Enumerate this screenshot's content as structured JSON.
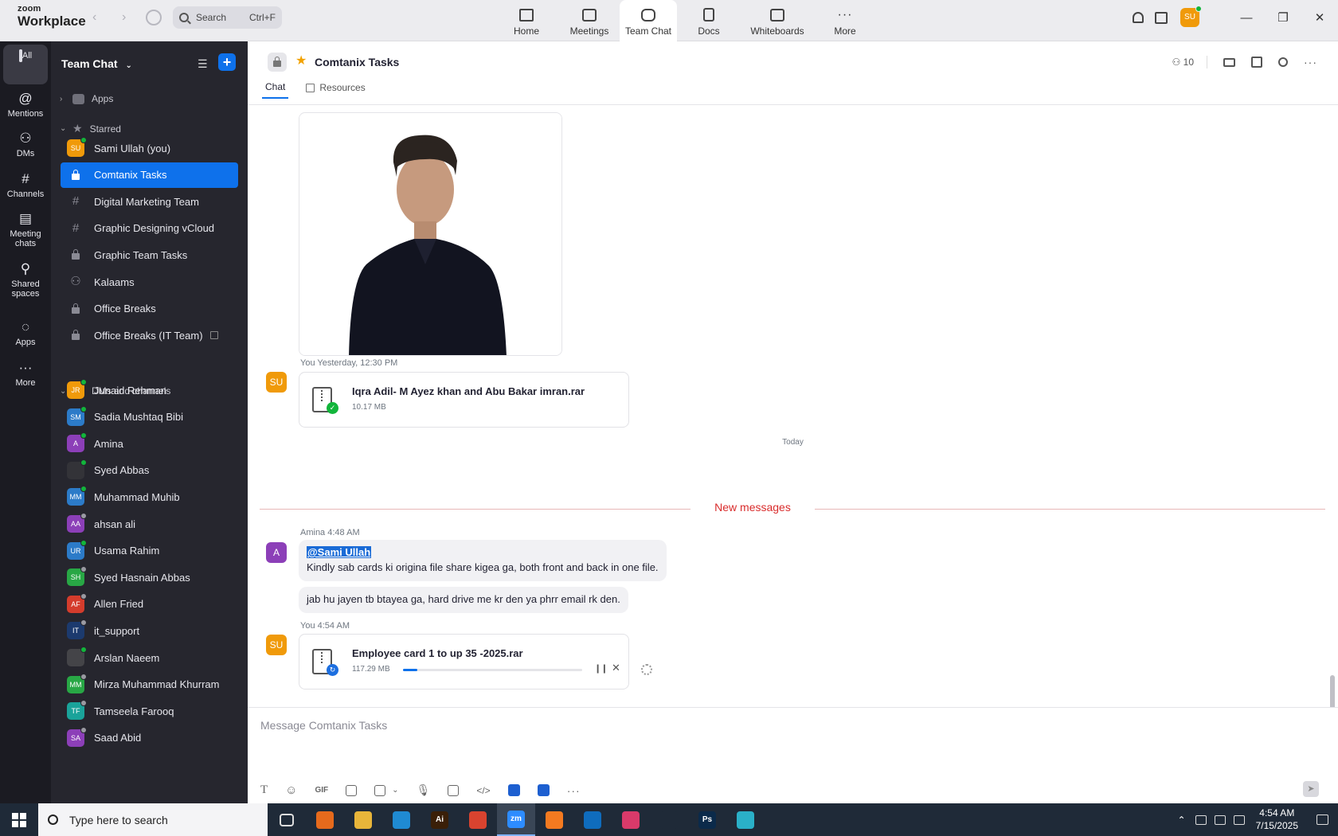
{
  "app": {
    "logo_small": "zoom",
    "logo_big": "Workplace"
  },
  "search": {
    "label": "Search",
    "shortcut": "Ctrl+F"
  },
  "topnav": [
    {
      "label": "Home",
      "icon": "home-icon"
    },
    {
      "label": "Meetings",
      "icon": "video-camera-icon"
    },
    {
      "label": "Team Chat",
      "icon": "chat-bubbles-icon",
      "active": true
    },
    {
      "label": "Docs",
      "icon": "document-icon"
    },
    {
      "label": "Whiteboards",
      "icon": "whiteboard-icon"
    },
    {
      "label": "More",
      "icon": "ellipsis-icon"
    }
  ],
  "user": {
    "initials": "SU",
    "status_color": "#12b53b",
    "avatar_color": "#f09a0a"
  },
  "rail": [
    {
      "label": "All",
      "glyph": "▣",
      "active": true
    },
    {
      "label": "Mentions",
      "glyph": "@"
    },
    {
      "label": "DMs",
      "glyph": "⚇"
    },
    {
      "label": "Channels",
      "glyph": "#"
    },
    {
      "label": "Meeting chats",
      "glyph": "▤"
    },
    {
      "label": "Shared spaces",
      "glyph": "⚲"
    },
    {
      "label": "Apps",
      "glyph": "◌"
    },
    {
      "label": "More",
      "glyph": "···"
    }
  ],
  "sidebar": {
    "title": "Team Chat",
    "sections": {
      "apps": "Apps",
      "starred": "Starred",
      "dms": "DMs and channels"
    },
    "starred": [
      {
        "label": "Sami Ullah (you)",
        "kind": "avatar",
        "initials": "SU",
        "color": "#f09a0a",
        "status": "#12b53b"
      },
      {
        "label": "Comtanix Tasks",
        "kind": "lock",
        "active": true
      },
      {
        "label": "Digital Marketing Team",
        "kind": "hash"
      },
      {
        "label": "Graphic Designing vCloud",
        "kind": "hash"
      },
      {
        "label": "Graphic Team Tasks",
        "kind": "lock"
      },
      {
        "label": "Kalaams",
        "kind": "group"
      },
      {
        "label": "Office Breaks",
        "kind": "lock"
      },
      {
        "label": "Office Breaks (IT Team)",
        "kind": "lock",
        "archived": true
      }
    ],
    "dms": [
      {
        "label": "Junaid Rehman",
        "initials": "JR",
        "color": "#f09a0a",
        "status": "#12b53b"
      },
      {
        "label": "Sadia Mushtaq Bibi",
        "initials": "SM",
        "color": "#2c7bc8",
        "status": "#12b53b"
      },
      {
        "label": "Amina",
        "initials": "A",
        "color": "#8c3fb8",
        "status": "#12b53b"
      },
      {
        "label": "Syed Abbas",
        "initials": "",
        "color": "#333338",
        "status": "#12b53b"
      },
      {
        "label": "Muhammad Muhib",
        "initials": "MM",
        "color": "#2c7bc8",
        "status": "#12b53b"
      },
      {
        "label": "ahsan ali",
        "initials": "AA",
        "color": "#8c3fb8",
        "status": "#9a9aa2"
      },
      {
        "label": "Usama Rahim",
        "initials": "UR",
        "color": "#2c7bc8",
        "status": "#12b53b"
      },
      {
        "label": "Syed Hasnain Abbas",
        "initials": "SH",
        "color": "#28a745",
        "status": "#9a9aa2"
      },
      {
        "label": "Allen Fried",
        "initials": "AF",
        "color": "#d43c2c",
        "status": "#9a9aa2"
      },
      {
        "label": "it_support",
        "initials": "IT",
        "color": "#1c3a6e",
        "status": "#9a9aa2"
      },
      {
        "label": "Arslan Naeem",
        "initials": "",
        "color": "#444448",
        "status": "#12b53b"
      },
      {
        "label": "Mirza Muhammad Khurram",
        "initials": "MM",
        "color": "#28a745",
        "status": "#9a9aa2"
      },
      {
        "label": "Tamseela Farooq",
        "initials": "TF",
        "color": "#1aa39a",
        "status": "#9a9aa2"
      },
      {
        "label": "Saad Abid",
        "initials": "SA",
        "color": "#8c3fb8",
        "status": "#9a9aa2"
      }
    ]
  },
  "channel": {
    "title": "Comtanix Tasks",
    "member_count": "10",
    "tabs": {
      "chat": "Chat",
      "resources": "Resources"
    }
  },
  "messages": {
    "file1": {
      "sender": "You",
      "time": "Yesterday, 12:30 PM",
      "initials": "SU",
      "name": "Iqra Adil- M Ayez khan and Abu Bakar imran.rar",
      "size": "10.17 MB"
    },
    "day_divider": "Today",
    "new_divider": "New messages",
    "amina": {
      "sender": "Amina",
      "time": "4:48 AM",
      "initials": "A",
      "mention": "@Sami Ullah",
      "line1": "Kindly sab cards ki origina file share kigea ga, both front and back in one file.",
      "line2": "jab hu jayen tb btayea ga, hard drive me kr den ya phrr email rk den."
    },
    "file2": {
      "sender": "You",
      "time": "4:54 AM",
      "initials": "SU",
      "name": "Employee card 1 to up 35 -2025.rar",
      "size": "117.29 MB",
      "progress": 0.08
    }
  },
  "composer": {
    "placeholder": "Message Comtanix Tasks",
    "gif": "GIF"
  },
  "taskbar": {
    "search_placeholder": "Type here to search",
    "time": "4:54 AM",
    "date": "7/15/2025",
    "apps": [
      {
        "name": "task-view",
        "color": "#1f2a38",
        "text": ""
      },
      {
        "name": "firefox",
        "color": "#e66a1c",
        "text": ""
      },
      {
        "name": "file-explorer",
        "color": "#e8b53a",
        "text": ""
      },
      {
        "name": "vscode",
        "color": "#1f8ad2",
        "text": ""
      },
      {
        "name": "illustrator",
        "color": "#3a1f08",
        "text": "Ai"
      },
      {
        "name": "chrome",
        "color": "#d9432f",
        "text": ""
      },
      {
        "name": "zoom",
        "color": "#2d8cff",
        "text": "zm",
        "active": true
      },
      {
        "name": "xampp",
        "color": "#f47a20",
        "text": ""
      },
      {
        "name": "outlook",
        "color": "#0f6cbd",
        "text": ""
      },
      {
        "name": "creative-cloud",
        "color": "#d93a6a",
        "text": ""
      },
      {
        "name": "pen-tool",
        "color": "#1f2a38",
        "text": ""
      },
      {
        "name": "photoshop",
        "color": "#0b2a4a",
        "text": "Ps"
      },
      {
        "name": "unknown-app",
        "color": "#2ab0c8",
        "text": ""
      }
    ]
  }
}
